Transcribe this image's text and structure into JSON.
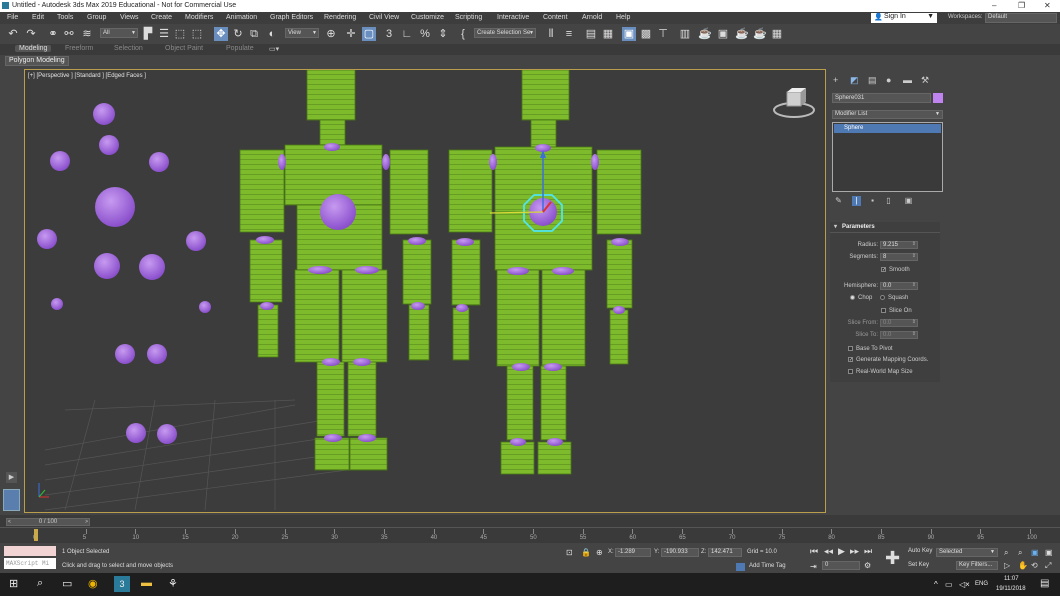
{
  "window": {
    "title": "Untitled - Autodesk 3ds Max 2019 Educational - Not for Commercial Use"
  },
  "menu": [
    "File",
    "Edit",
    "Tools",
    "Group",
    "Views",
    "Create",
    "Modifiers",
    "Animation",
    "Graph Editors",
    "Rendering",
    "Civil View",
    "Customize",
    "Scripting",
    "Interactive",
    "Content",
    "Arnold",
    "Help"
  ],
  "account": {
    "sign_in": "Sign In",
    "workspaces_label": "Workspaces:",
    "workspace": "Default"
  },
  "toolbar": {
    "filter": "All",
    "ref_coord": "View",
    "selection_set": "Create Selection Se"
  },
  "ribbon": {
    "tabs": [
      "Modeling",
      "Freeform",
      "Selection",
      "Object Paint",
      "Populate"
    ],
    "active": "Modeling",
    "sub": "Polygon Modeling"
  },
  "viewport": {
    "label": "[+] [Perspective ] [Standard ] [Edged Faces ]",
    "colors": {
      "body": "#7dbb2c",
      "sphere": "#a868e0",
      "border": "#b89e4d"
    }
  },
  "command_panel": {
    "object_name": "Sphere031",
    "modifier_list": "Modifier List",
    "stack_item": "Sphere",
    "params_title": "Parameters",
    "radius_label": "Radius:",
    "radius": "9.215",
    "segments_label": "Segments:",
    "segments": "8",
    "smooth": "Smooth",
    "hemisphere_label": "Hemisphere:",
    "hemisphere": "0.0",
    "chop": "Chop",
    "squash": "Squash",
    "slice_on": "Slice On",
    "slice_from_label": "Slice From:",
    "slice_from": "0.0",
    "slice_to_label": "Slice To:",
    "slice_to": "0.0",
    "base_to_pivot": "Base To Pivot",
    "gen_mapping": "Generate Mapping Coords.",
    "real_world": "Real-World Map Size"
  },
  "timeline": {
    "slider": "0 / 100",
    "ticks": [
      "0",
      "5",
      "10",
      "15",
      "20",
      "25",
      "30",
      "35",
      "40",
      "45",
      "50",
      "55",
      "60",
      "65",
      "70",
      "75",
      "80",
      "85",
      "90",
      "95",
      "100"
    ]
  },
  "status": {
    "selected": "1 Object Selected",
    "prompt": "Click and drag to select and move objects",
    "maxscript": "MAXScript Mi",
    "x_label": "X:",
    "x": "-1.289",
    "y_label": "Y:",
    "y": "-190.933",
    "z_label": "Z:",
    "z": "142.471",
    "grid": "Grid = 10.0",
    "add_time_tag": "Add Time Tag",
    "frame": "0",
    "auto_key": "Auto Key",
    "set_key": "Set Key",
    "key_mode": "Selected",
    "key_filters": "Key Filters..."
  },
  "taskbar": {
    "lang": "ENG",
    "time": "11:07",
    "date": "19/11/2018"
  }
}
